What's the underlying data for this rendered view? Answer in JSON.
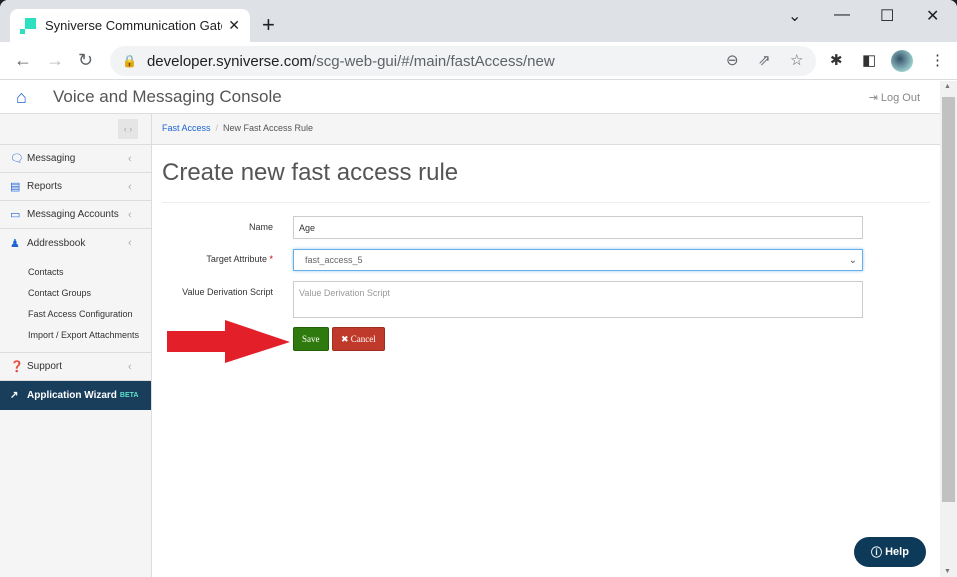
{
  "browser": {
    "tab_title": "Syniverse Communication Gateway",
    "url_host": "developer.syniverse.com",
    "url_path": "/scg-web-gui/#/main/fastAccess/new"
  },
  "header": {
    "title": "Voice and Messaging Console",
    "logout": "Log Out"
  },
  "sidebar": {
    "items": [
      {
        "label": "Messaging",
        "icon": "chat-icon"
      },
      {
        "label": "Reports",
        "icon": "report-icon"
      },
      {
        "label": "Messaging Accounts",
        "icon": "monitor-icon"
      },
      {
        "label": "Addressbook",
        "icon": "user-icon"
      }
    ],
    "subitems": [
      "Contacts",
      "Contact Groups",
      "Fast Access Configuration",
      "Import / Export Attachments"
    ],
    "support": "Support",
    "wizard": "Application Wizard",
    "wizard_badge": "BETA"
  },
  "breadcrumb": {
    "parent": "Fast Access",
    "current": "New Fast Access Rule"
  },
  "page_title": "Create new fast access rule",
  "form": {
    "name_label": "Name",
    "name_value": "Age",
    "target_label": "Target Attribute",
    "target_required": "*",
    "target_value": "fast_access_5",
    "script_label": "Value Derivation Script",
    "script_placeholder": "Value Derivation Script",
    "save": "Save",
    "cancel": "Cancel"
  },
  "help": "Help",
  "colors": {
    "accent": "#1e63d6",
    "save": "#2f7a0e",
    "cancel": "#c03a2b",
    "wizard_bg": "#183e5c",
    "annotation_arrow": "#e3202a"
  }
}
